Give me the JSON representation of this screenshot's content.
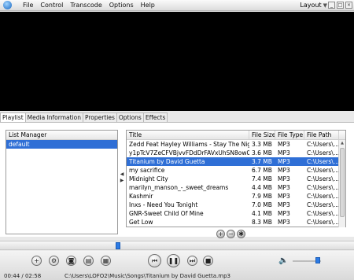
{
  "menubar": {
    "items": [
      "File",
      "Control",
      "Transcode",
      "Options",
      "Help"
    ],
    "layout_label": "Layout"
  },
  "tabs": [
    "Playlist",
    "Media Information",
    "Properties",
    "Options",
    "Effects"
  ],
  "list_manager": {
    "header": "List Manager",
    "items": [
      "default"
    ]
  },
  "tracks": {
    "columns": [
      "Title",
      "File Size",
      "File Type",
      "File Path"
    ],
    "rows": [
      {
        "title": "Zedd Feat Hayley Williams - Stay The Night...",
        "size": "3.3 MB",
        "type": "MP3",
        "path": "C:\\Users\\..."
      },
      {
        "title": "y1pTcV7ZeCFVBjvvFDdDrFAVxUhSN8ow0lr...",
        "size": "3.6 MB",
        "type": "MP3",
        "path": "C:\\Users\\..."
      },
      {
        "title": "Titanium by David Guetta",
        "size": "3.7 MB",
        "type": "MP3",
        "path": "C:\\Users\\..."
      },
      {
        "title": "my sacrifice",
        "size": "6.7 MB",
        "type": "MP3",
        "path": "C:\\Users\\..."
      },
      {
        "title": "Midnight City",
        "size": "7.4 MB",
        "type": "MP3",
        "path": "C:\\Users\\..."
      },
      {
        "title": "marilyn_manson_-_sweet_dreams",
        "size": "4.4 MB",
        "type": "MP3",
        "path": "C:\\Users\\..."
      },
      {
        "title": "Kashmir",
        "size": "7.9 MB",
        "type": "MP3",
        "path": "C:\\Users\\..."
      },
      {
        "title": "Inxs -  Need You Tonight",
        "size": "7.0 MB",
        "type": "MP3",
        "path": "C:\\Users\\..."
      },
      {
        "title": "GNR-Sweet Child Of Mine",
        "size": "4.1 MB",
        "type": "MP3",
        "path": "C:\\Users\\..."
      },
      {
        "title": "Get Low",
        "size": "8.3 MB",
        "type": "MP3",
        "path": "C:\\Users\\..."
      }
    ],
    "selected_index": 2
  },
  "status": {
    "time": "00:44 / 02:58",
    "file": "C:\\Users\\LOFO2\\Music\\Songs\\Titanium by David Guetta.mp3"
  },
  "playback": {
    "position_fraction": 0.33,
    "volume_fraction": 0.8
  },
  "colors": {
    "selection": "#2f6fd6",
    "accent": "#2c7be5"
  }
}
